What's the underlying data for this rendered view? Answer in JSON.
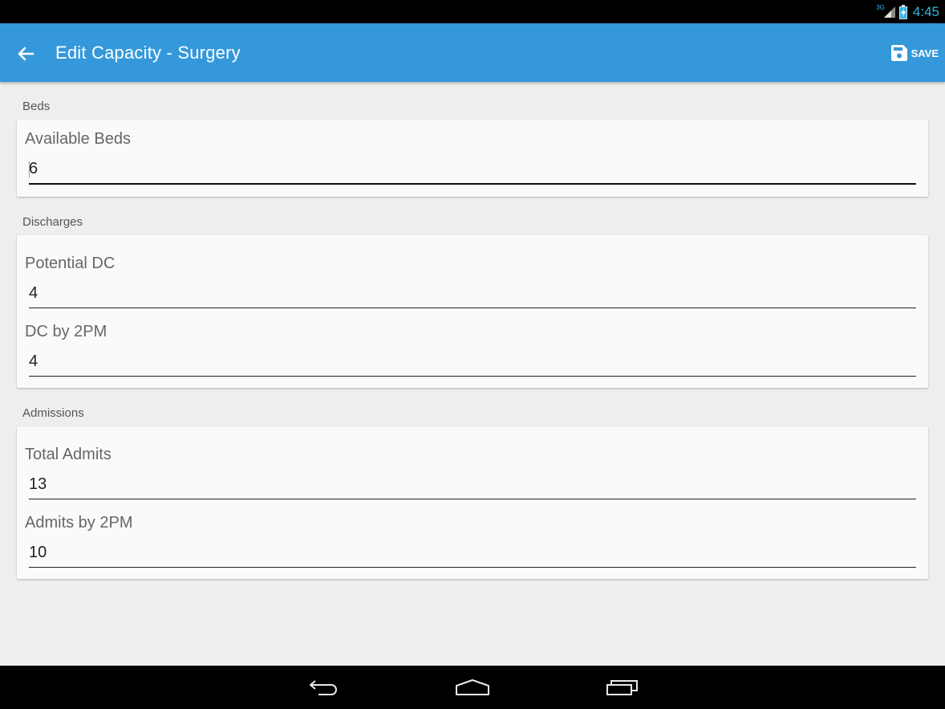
{
  "status_bar": {
    "network": "3G",
    "time": "4:45",
    "accent": "#33b5e5"
  },
  "app_bar": {
    "title": "Edit Capacity - Surgery",
    "back_icon": "arrow-left-icon",
    "save_icon": "floppy-disk-icon",
    "save_label": "SAVE",
    "color": "#3498db"
  },
  "sections": {
    "beds": {
      "header": "Beds",
      "available_beds": {
        "label": "Available Beds",
        "value": "6"
      }
    },
    "discharges": {
      "header": "Discharges",
      "potential_dc": {
        "label": "Potential DC",
        "value": "4"
      },
      "dc_by_2pm": {
        "label": "DC by 2PM",
        "value": "4"
      }
    },
    "admissions": {
      "header": "Admissions",
      "total_admits": {
        "label": "Total Admits",
        "value": "13"
      },
      "admits_by_2pm": {
        "label": "Admits by 2PM",
        "value": "10"
      }
    }
  },
  "nav_bar": {
    "back_icon": "nav-back-icon",
    "home_icon": "nav-home-icon",
    "recents_icon": "nav-recents-icon"
  }
}
